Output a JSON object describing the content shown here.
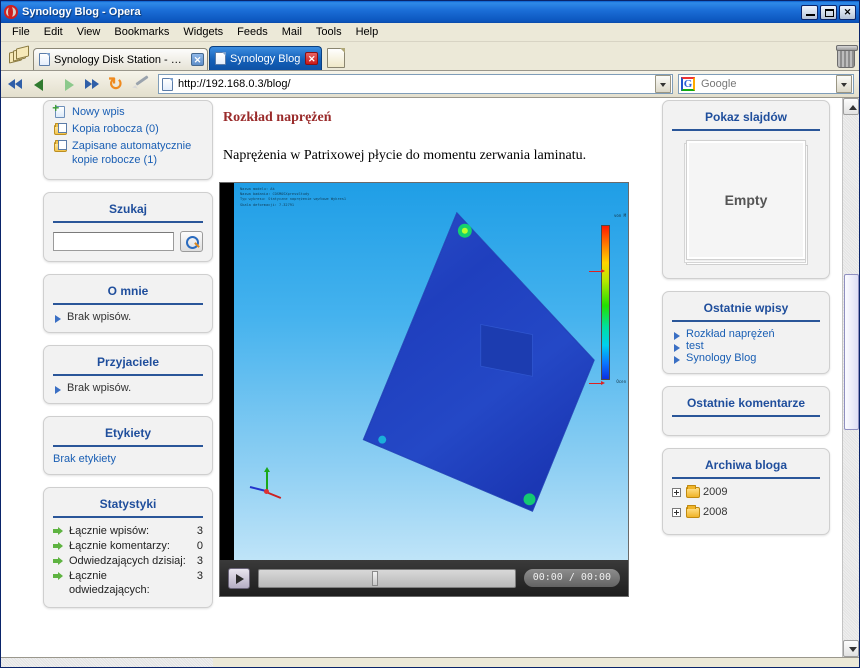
{
  "window": {
    "title": "Synology Blog - Opera",
    "controls": {
      "minimize": "_",
      "maximize": "□",
      "close": "✕"
    }
  },
  "menubar": {
    "items": [
      "File",
      "Edit",
      "View",
      "Bookmarks",
      "Widgets",
      "Feeds",
      "Mail",
      "Tools",
      "Help"
    ]
  },
  "tabs": [
    {
      "label": "Synology Disk Station - D...",
      "active": false,
      "close": "✕"
    },
    {
      "label": "Synology Blog",
      "active": true,
      "close": "✕"
    }
  ],
  "navbar": {
    "address": "http://192.168.0.3/blog/",
    "search_engine": "Google",
    "search_logo": "G",
    "icons": [
      "rewind-icon",
      "back-icon",
      "forward-icon",
      "fast-forward-icon",
      "reload-icon",
      "edit-icon"
    ]
  },
  "sidebar_left": {
    "entries_box": {
      "items": [
        {
          "label": "Nowy wpis",
          "icon": "new-document-icon"
        },
        {
          "label": "Kopia robocza (0)",
          "icon": "folder-document-icon"
        },
        {
          "label": "Zapisane automatycznie kopie robocze (1)",
          "icon": "folder-document-icon"
        }
      ]
    },
    "search_box": {
      "title": "Szukaj",
      "value": "",
      "placeholder": "",
      "button_icon": "search-icon"
    },
    "about_box": {
      "title": "O mnie",
      "empty_text": "Brak wpisów."
    },
    "friends_box": {
      "title": "Przyjaciele",
      "empty_text": "Brak wpisów."
    },
    "tags_box": {
      "title": "Etykiety",
      "empty_text": "Brak etykiety"
    },
    "stats_box": {
      "title": "Statystyki",
      "rows": [
        {
          "label": "Łącznie wpisów:",
          "value": "3"
        },
        {
          "label": "Łącznie komentarzy:",
          "value": "0"
        },
        {
          "label": "Odwiedzających dzisiaj:",
          "value": "3"
        },
        {
          "label": "Łącznie odwiedzających:",
          "value": "3"
        }
      ]
    }
  },
  "main": {
    "post_title": "Rozkład naprężeń",
    "post_body": "Naprężenia w Patrixowej płycie do momentu zerwania laminatu.",
    "video": {
      "overlay_lines": "Nazwa modelu: Ak\nNazwa badania: COSMOSXpressStudy\nTyp wykresu: Statyczne naprężenie węzłowe Wykres1\nSkala deformacji: 7.32791",
      "play_icon": "play-icon",
      "time": "00:00 / 00:00",
      "seek_position_percent": 44,
      "legend_top_label": "von M",
      "legend_bottom_label": "Ocen"
    }
  },
  "sidebar_right": {
    "slideshow_box": {
      "title": "Pokaz slajdów",
      "empty_text": "Empty"
    },
    "recent_posts_box": {
      "title": "Ostatnie wpisy",
      "items": [
        "Rozkład naprężeń",
        "test",
        "Synology Blog"
      ]
    },
    "recent_comments_box": {
      "title": "Ostatnie komentarze",
      "items": []
    },
    "archives_box": {
      "title": "Archiwa bloga",
      "items": [
        {
          "label": "2009",
          "expander": "+",
          "icon": "folder-icon"
        },
        {
          "label": "2008",
          "expander": "+",
          "icon": "folder-icon"
        }
      ]
    }
  },
  "colors": {
    "accent_blue": "#2a5699",
    "link_blue": "#1a5fb4",
    "title_red": "#9a2b2b",
    "tab_active": "#1460b8"
  }
}
